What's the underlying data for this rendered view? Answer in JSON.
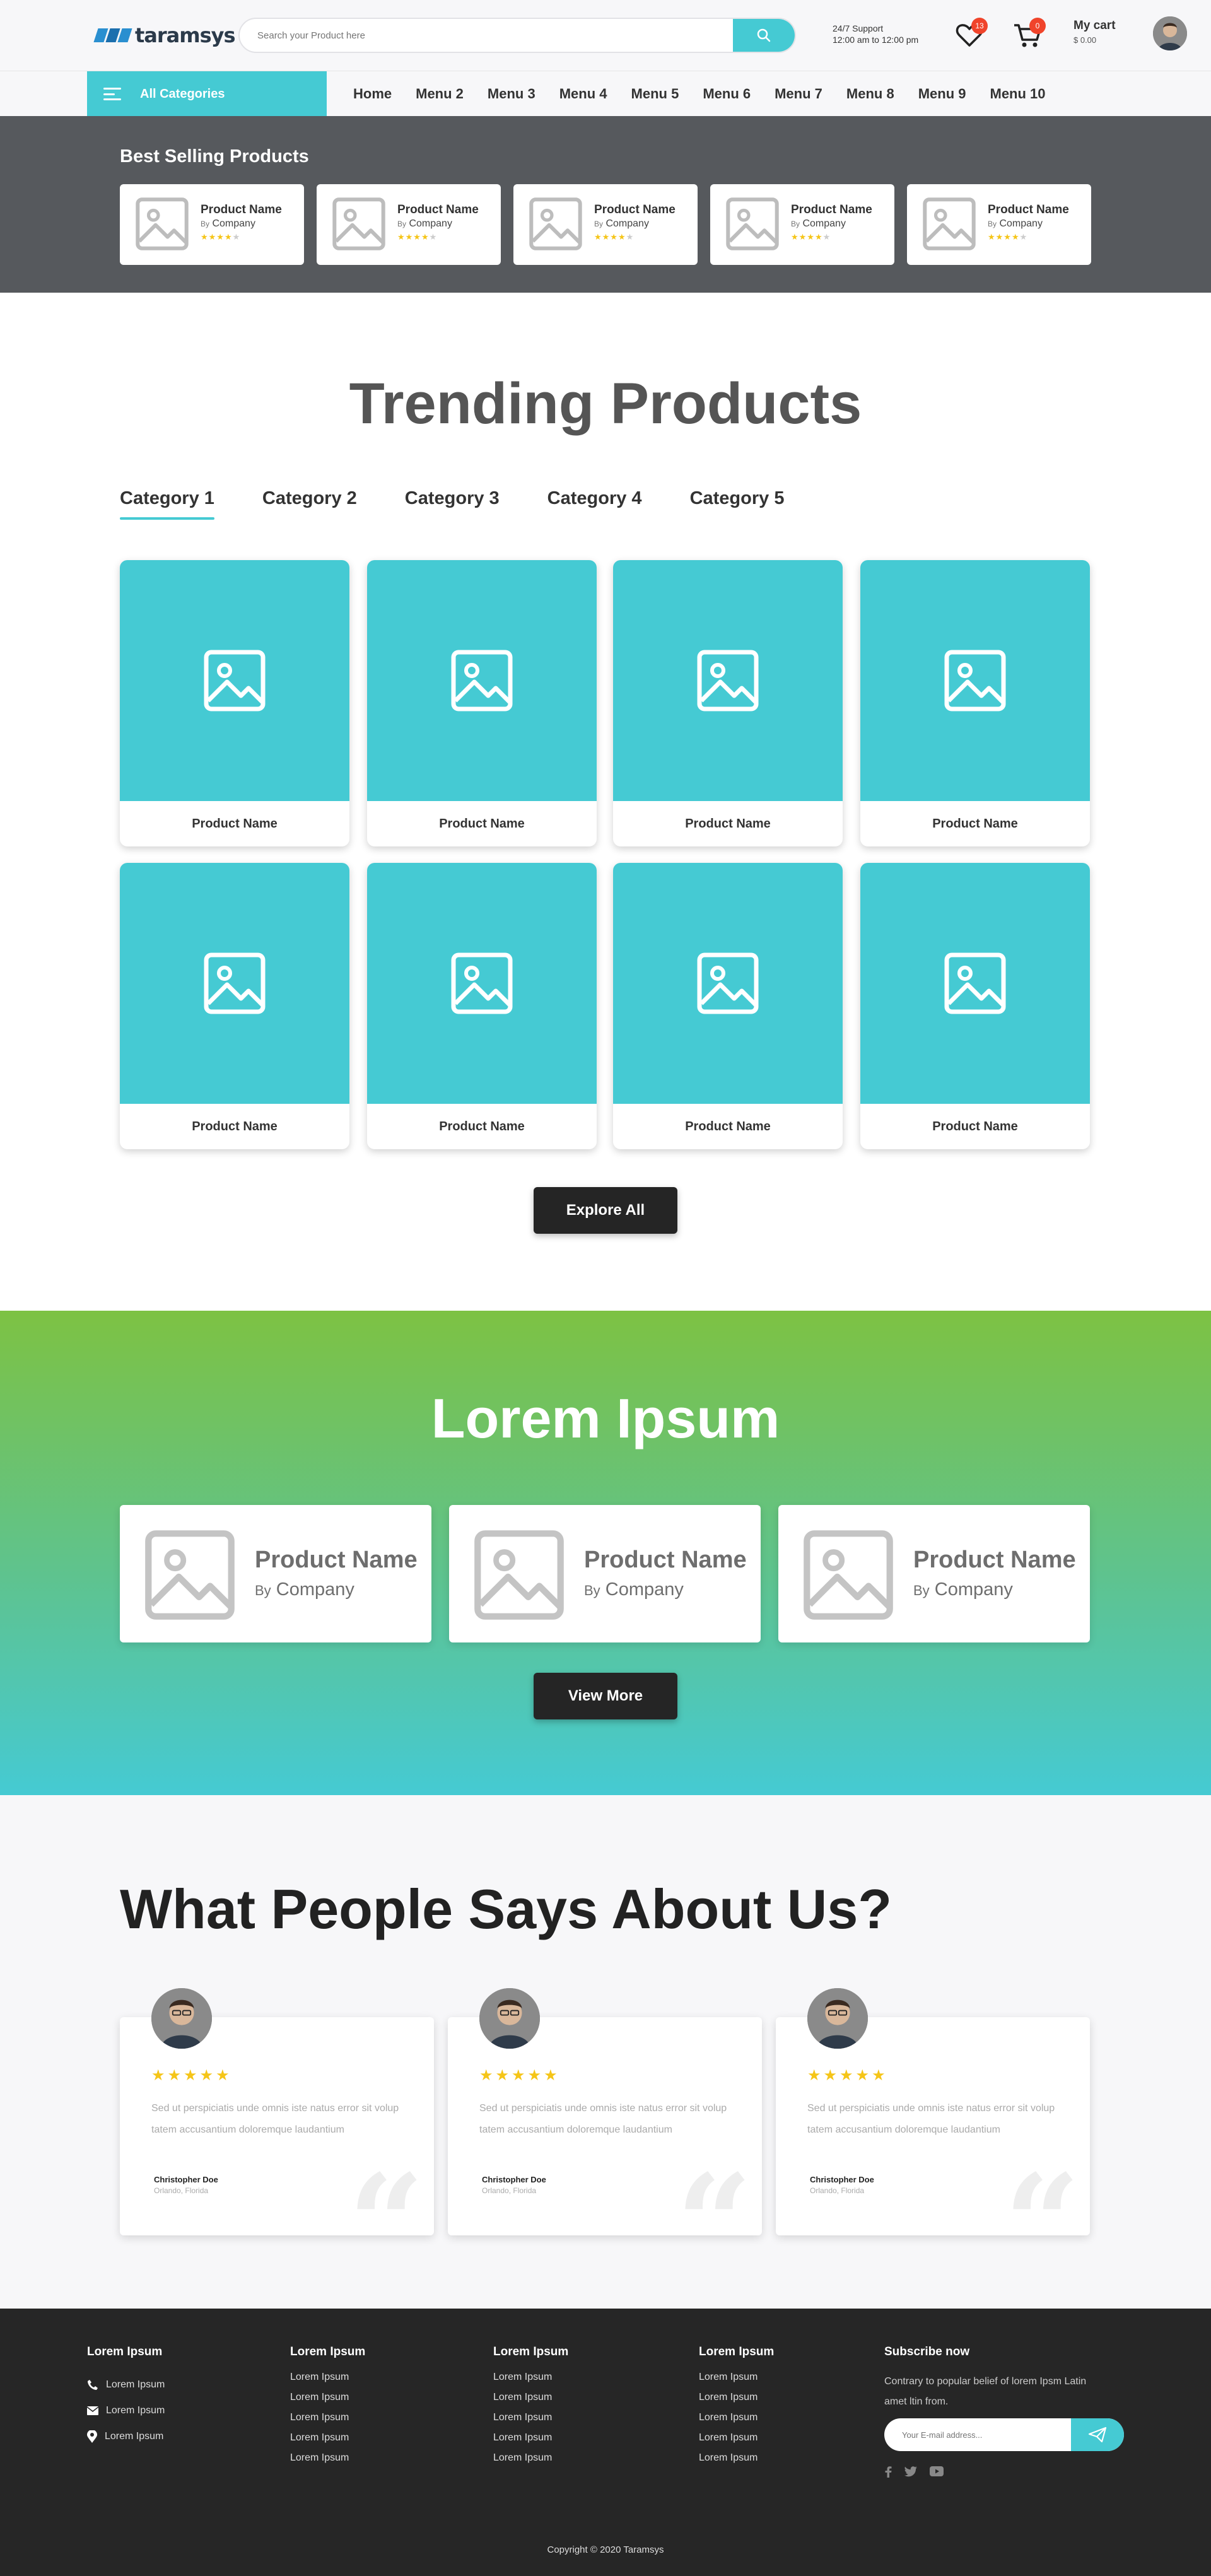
{
  "brand": {
    "logo_text": "taramsys"
  },
  "search": {
    "placeholder": "Search your Product here"
  },
  "support": {
    "line1": "24/7 Support",
    "line2": "12:00 am to 12:00 pm"
  },
  "wishlist": {
    "count": "13"
  },
  "cart": {
    "count": "0",
    "title": "My cart",
    "amount": "$ 0.00"
  },
  "nav": {
    "all_categories": "All Categories",
    "menu": [
      "Home",
      "Menu 2",
      "Menu 3",
      "Menu 4",
      "Menu 5",
      "Menu 6",
      "Menu 7",
      "Menu 8",
      "Menu 9",
      "Menu 10"
    ]
  },
  "best_selling": {
    "title": "Best Selling Products",
    "items": [
      {
        "name": "Product Name",
        "by": "By",
        "company": "Company",
        "rating": 4
      },
      {
        "name": "Product Name",
        "by": "By",
        "company": "Company",
        "rating": 4
      },
      {
        "name": "Product Name",
        "by": "By",
        "company": "Company",
        "rating": 4
      },
      {
        "name": "Product Name",
        "by": "By",
        "company": "Company",
        "rating": 4
      },
      {
        "name": "Product Name",
        "by": "By",
        "company": "Company",
        "rating": 4
      }
    ]
  },
  "trending": {
    "title": "Trending Products",
    "categories": [
      "Category 1",
      "Category 2",
      "Category 3",
      "Category 4",
      "Category 5"
    ],
    "active_category": 0,
    "products": [
      "Product Name",
      "Product Name",
      "Product Name",
      "Product Name",
      "Product Name",
      "Product Name",
      "Product Name",
      "Product Name"
    ],
    "explore_label": "Explore All"
  },
  "lorem": {
    "title": "Lorem Ipsum",
    "items": [
      {
        "name": "Product Name",
        "by": "By",
        "company": "Company"
      },
      {
        "name": "Product Name",
        "by": "By",
        "company": "Company"
      },
      {
        "name": "Product Name",
        "by": "By",
        "company": "Company"
      }
    ],
    "view_more_label": "View More"
  },
  "testimonials": {
    "title": "What People Says About Us?",
    "items": [
      {
        "stars": "★★★★★",
        "text": "Sed ut perspiciatis unde omnis iste natus error sit volup tatem accusantium doloremque laudantium",
        "name": "Christopher Doe",
        "location": "Orlando, Florida"
      },
      {
        "stars": "★★★★★",
        "text": "Sed ut perspiciatis unde omnis iste natus error sit volup tatem accusantium doloremque laudantium",
        "name": "Christopher Doe",
        "location": "Orlando, Florida"
      },
      {
        "stars": "★★★★★",
        "text": "Sed ut perspiciatis unde omnis iste natus error sit volup tatem accusantium doloremque laudantium",
        "name": "Christopher Doe",
        "location": "Orlando, Florida"
      }
    ]
  },
  "footer": {
    "contact": {
      "title": "Lorem Ipsum",
      "phone": "Lorem Ipsum",
      "email": "Lorem Ipsum",
      "address": "Lorem Ipsum"
    },
    "columns": [
      {
        "title": "Lorem Ipsum",
        "links": [
          "Lorem Ipsum",
          "Lorem Ipsum",
          "Lorem Ipsum",
          "Lorem Ipsum",
          "Lorem Ipsum"
        ]
      },
      {
        "title": "Lorem Ipsum",
        "links": [
          "Lorem Ipsum",
          "Lorem Ipsum",
          "Lorem Ipsum",
          "Lorem Ipsum",
          "Lorem Ipsum"
        ]
      },
      {
        "title": "Lorem Ipsum",
        "links": [
          "Lorem Ipsum",
          "Lorem Ipsum",
          "Lorem Ipsum",
          "Lorem Ipsum",
          "Lorem Ipsum"
        ]
      }
    ],
    "subscribe": {
      "title": "Subscribe now",
      "text": "Contrary to popular belief of lorem Ipsm Latin amet ltin from.",
      "placeholder": "Your E-mail address..."
    },
    "copyright": "Copyright © 2020 Taramsys"
  },
  "colors": {
    "accent": "#45cad3",
    "dark": "#252525",
    "band_top": "#7dc243",
    "band_bottom": "#45cad3",
    "star": "#f5c518",
    "badge": "#f0442b"
  },
  "icons": [
    "search-icon",
    "heart-icon",
    "cart-icon",
    "menu-icon",
    "image-placeholder-icon",
    "quote-icon",
    "phone-icon",
    "mail-icon",
    "location-icon",
    "send-icon",
    "facebook-icon",
    "twitter-icon",
    "youtube-icon"
  ]
}
